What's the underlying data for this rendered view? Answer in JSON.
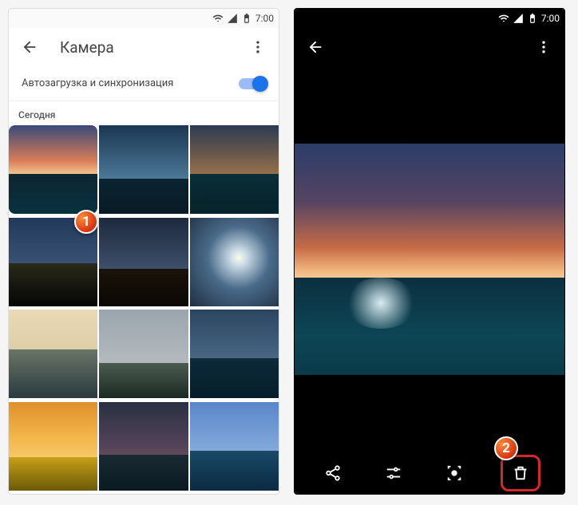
{
  "status": {
    "time": "7:00"
  },
  "left": {
    "title": "Камера",
    "sync_label": "Автозагрузка и синхронизация",
    "section": "Сегодня",
    "thumbs": [
      {
        "sky": "linear-gradient(180deg,#3a4a7a 0%,#d87c58 40%,#f3c28f 55%)",
        "land": "45%",
        "land_bg": "linear-gradient(180deg,#0e2530,#08323f)",
        "selected": true
      },
      {
        "sky": "linear-gradient(180deg,#1b3652,#4b7896 60%,#7ca1b6)",
        "land": "40%",
        "land_bg": "linear-gradient(180deg,#0b2431,#081b25)"
      },
      {
        "sky": "linear-gradient(180deg,#2a3a52,#8c6a4a 50%,#caa972)",
        "land": "45%",
        "land_bg": "linear-gradient(180deg,#0a2e38,#05232b)"
      },
      {
        "sky": "linear-gradient(180deg,#213a5c,#50688a)",
        "land": "48%",
        "land_bg": "linear-gradient(180deg,#2a2a1a,#050505)"
      },
      {
        "sky": "linear-gradient(180deg,#1e2a3e,#3c4d68 55%,#54637a)",
        "land": "42%",
        "land_bg": "linear-gradient(180deg,#1a1308,#0a0704)"
      },
      {
        "sky": "radial-gradient(circle at 55% 45%,#fffbe0 0%,#d0e0ea 10%,#4a6b8a 45%,#1e2e40 100%)",
        "land": "0%",
        "land_bg": ""
      },
      {
        "sky": "linear-gradient(180deg,#e9d9b4,#d0c19a)",
        "land": "55%",
        "land_bg": "linear-gradient(180deg,#6a7568,#2a3a3e)"
      },
      {
        "sky": "linear-gradient(180deg,#9aa5ad,#c3c7c8)",
        "land": "40%",
        "land_bg": "linear-gradient(180deg,#4c5c50,#1a2a22)"
      },
      {
        "sky": "linear-gradient(180deg,#2b4560,#4a6a86 60%,#7a97ab)",
        "land": "45%",
        "land_bg": "linear-gradient(180deg,#0c2a3a,#061e2a)"
      },
      {
        "sky": "linear-gradient(180deg,#e0902a,#f3b64a 40%,#fce79a)",
        "land": "38%",
        "land_bg": "linear-gradient(180deg,#c8a018,#6a5a08)"
      },
      {
        "sky": "linear-gradient(180deg,#2a3142,#54435a 50%,#a06a52)",
        "land": "40%",
        "land_bg": "linear-gradient(180deg,#1a2a32,#0a1a22)"
      },
      {
        "sky": "linear-gradient(180deg,#5a86ca,#a5c7e8)",
        "land": "45%",
        "land_bg": "linear-gradient(180deg,#1a4a68,#0a2a40)"
      }
    ]
  },
  "right": {
    "big_photo": {
      "sky": "linear-gradient(180deg,#2b3d68 0%,#554463 25%,#c76b46 45%,#f2b77f 55%,#f7dfb2 62%)",
      "land_h": "42%",
      "land": "linear-gradient(180deg,#0b3040 0%,#0d4656 60%,#0a3a48 100%)"
    }
  },
  "steps": {
    "one": "1",
    "two": "2"
  }
}
